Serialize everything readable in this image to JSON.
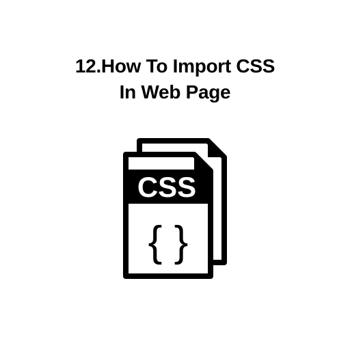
{
  "heading": {
    "line1": "12.How To Import CSS",
    "line2": "In Web Page"
  },
  "icon": {
    "label": "CSS",
    "braces": "{ }"
  }
}
